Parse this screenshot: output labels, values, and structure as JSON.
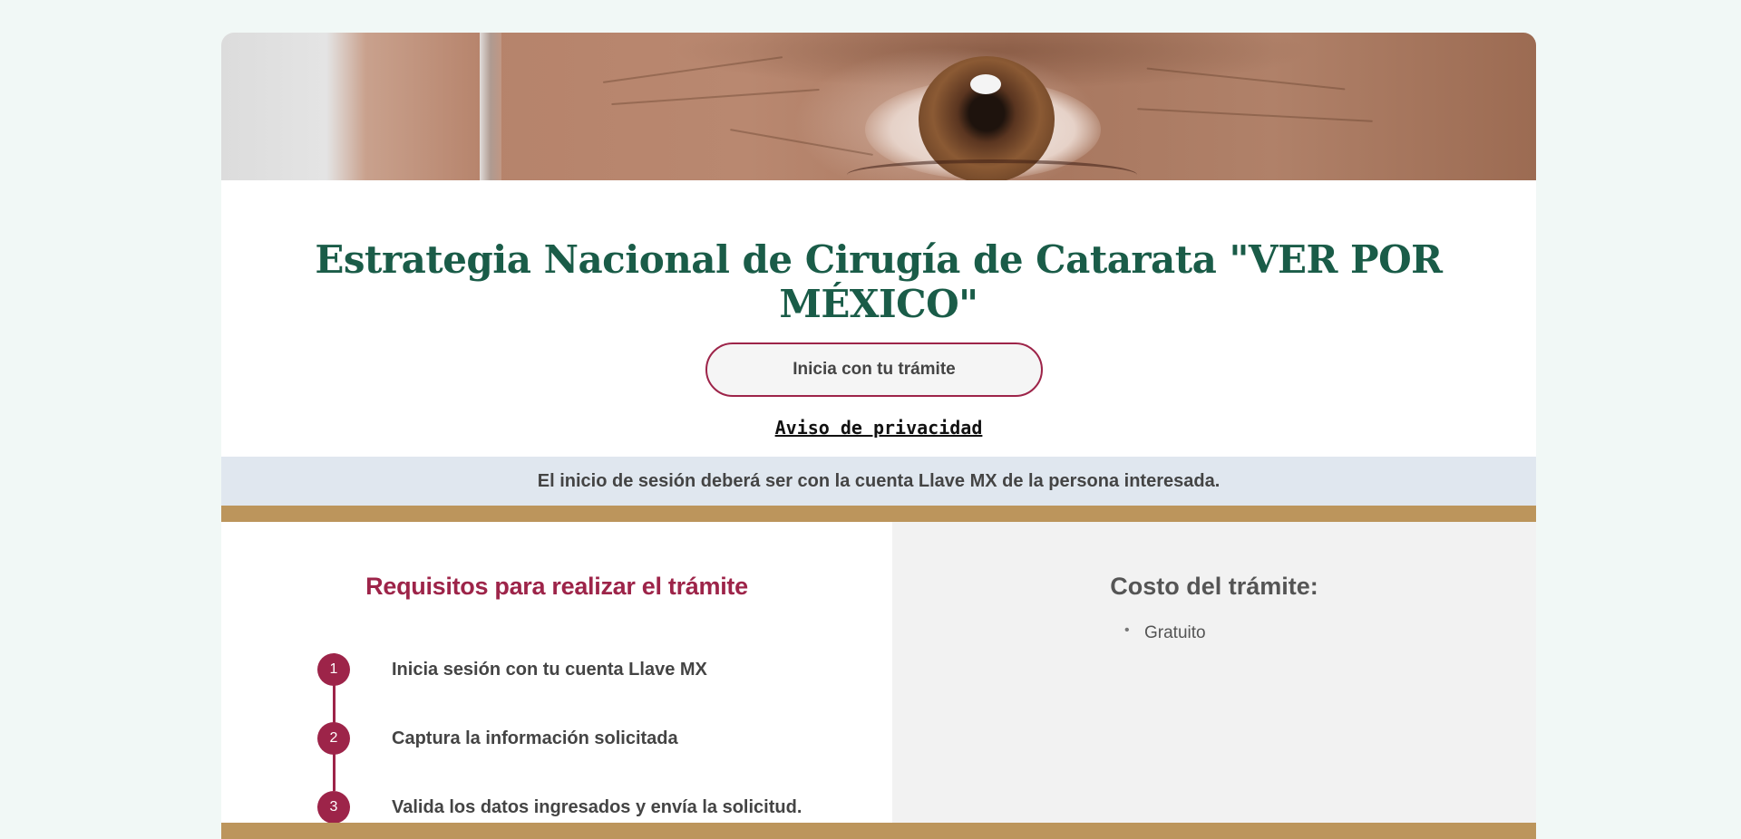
{
  "header": {
    "hero_image": "eye-closeup-photo",
    "title": "Estrategia Nacional de Cirugía de Catarata \"VER POR MÉXICO\""
  },
  "actions": {
    "start_label": "Inicia con tu trámite",
    "privacy_label": "Aviso de privacidad"
  },
  "notice": {
    "text": "El inicio de sesión deberá ser con la cuenta Llave MX de la persona interesada."
  },
  "requirements": {
    "title": "Requisitos para realizar el trámite",
    "steps": [
      {
        "number": "1",
        "label": "Inicia sesión con tu cuenta Llave MX"
      },
      {
        "number": "2",
        "label": "Captura la información solicitada"
      },
      {
        "number": "3",
        "label": "Valida los datos ingresados y envía la solicitud."
      }
    ]
  },
  "cost": {
    "title": "Costo del trámite:",
    "items": [
      "Gratuito"
    ]
  },
  "colors": {
    "title_green": "#1a5c48",
    "accent_guinda": "#9d2449",
    "gold": "#bc955c",
    "notice_bg": "#e0e7ef",
    "page_bg": "#f1f8f6"
  }
}
